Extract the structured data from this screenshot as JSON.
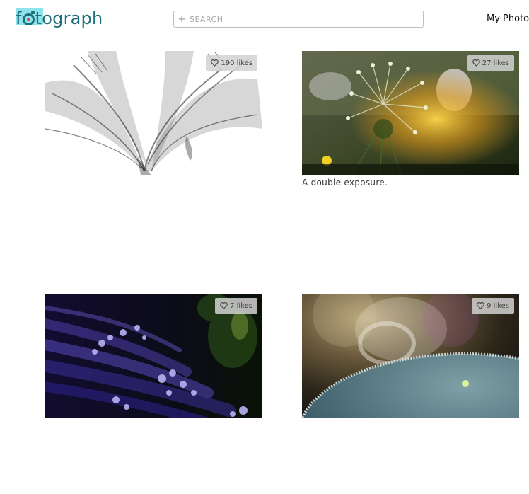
{
  "header": {
    "logo": {
      "text_f": "f",
      "text_rest": "tograph"
    },
    "search": {
      "icon": "+",
      "placeholder": "SEARCH",
      "value": ""
    },
    "nav": {
      "my_photos": "My Photos"
    }
  },
  "photos": [
    {
      "likes": "190 likes",
      "caption": ""
    },
    {
      "likes": "27 likes",
      "caption": "A double exposure."
    },
    {
      "likes": "7 likes",
      "caption": ""
    },
    {
      "likes": "9 likes",
      "caption": ""
    }
  ],
  "icons": {
    "heart": "heart-icon",
    "plus": "plus-icon"
  },
  "colors": {
    "brand": "#1f6f7a",
    "logo_highlight": "#8fe3ec",
    "logo_dot": "#e0495b"
  }
}
